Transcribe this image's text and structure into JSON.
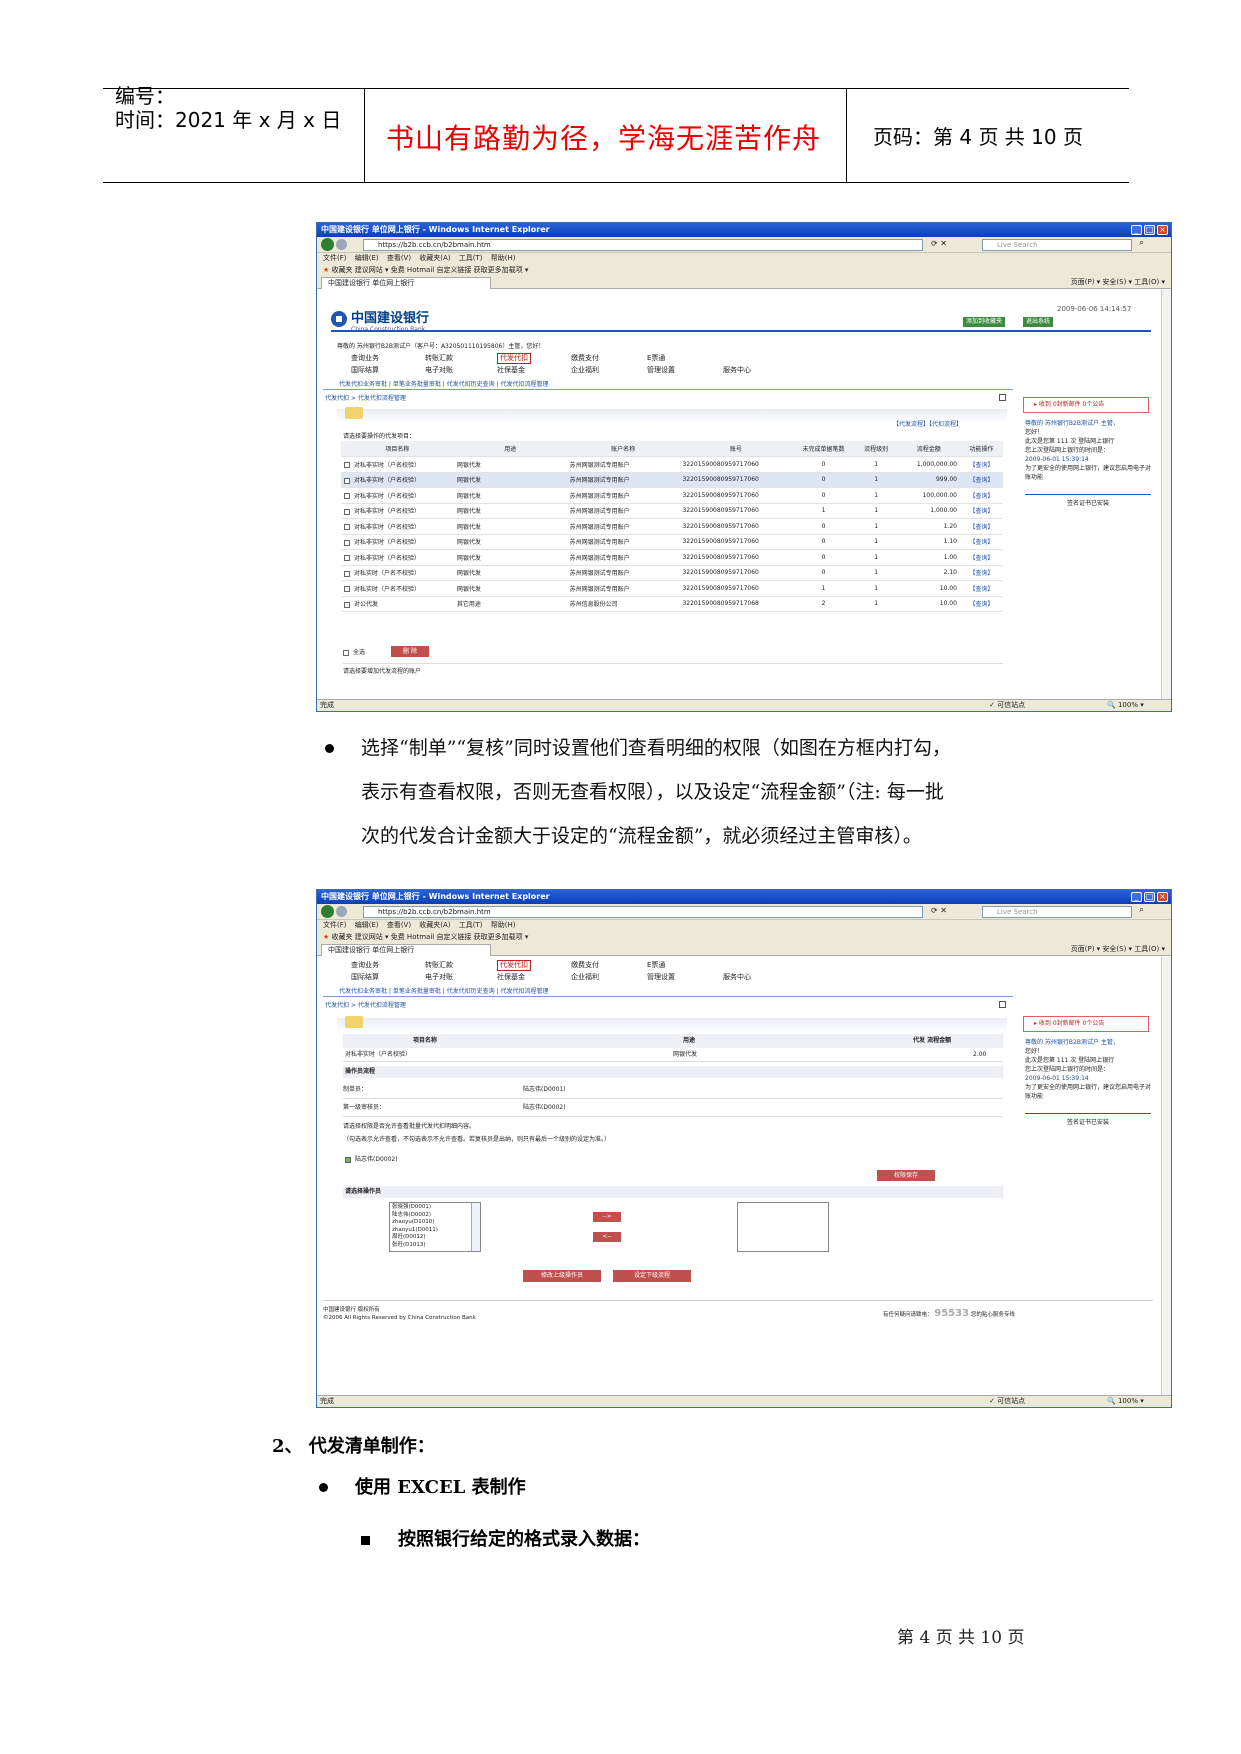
{
  "header": {
    "number_label": "编号：",
    "time_label": "时间：2021 年 x 月 x 日",
    "motto": "书山有路勤为径，学海无涯苦作舟",
    "page_label": "页码：第 4 页  共 10 页"
  },
  "browser": {
    "title": "中国建设银行 单位网上银行 - Windows Internet Explorer",
    "address1": "https://b2b.ccb.cn/b2bmain.htm",
    "address2": "https://b2b.ccb.cn/b2bmain.htm",
    "search_placeholder": "Live Search",
    "menu": "文件(F) 编辑(E) 查看(V) 收藏夹(A) 工具(T) 帮助(H)",
    "favorites": "收藏夹   建议网站 ▾   免费 Hotmail   自定义链接   获取更多加载项 ▾",
    "tab": "中国建设银行 单位网上银行",
    "tools": "页面(P) ▾  安全(S) ▾  工具(O) ▾",
    "status_done": "完成",
    "status_zone": "可信站点",
    "status_zoom": "100%"
  },
  "bank": {
    "name": "中国建设银行",
    "name_en": "China Construction Bank",
    "datetime": "2009-06-06 14:14:57",
    "btn_favorite": "添加到收藏夹",
    "btn_exit": "退出系统",
    "welcome": "尊敬的 苏州银行B2B测试户（客户号：A320501110195806）主管，您好！",
    "nav_row1": [
      "查询业务",
      "转账汇款",
      "代发代扣",
      "缴费支付",
      "E票通"
    ],
    "nav_row2": [
      "国际结算",
      "电子对账",
      "社保基金",
      "企业福利",
      "管理设置",
      "服务中心"
    ],
    "subnav": "代发代扣业务审批 | 单笔业务批量审批 | 代发代扣历史查询 | 代发代扣流程管理",
    "breadcrumb": "代发代扣 > 代发代扣流程管理"
  },
  "window1": {
    "top_links": "【代发流程】【代扣流程】",
    "prompt": "请选择要操作的代发项目：",
    "columns": [
      "项目名称",
      "用途",
      "账户名称",
      "账号",
      "未完成单据笔数",
      "流程级别",
      "流程金额",
      "功能操作"
    ],
    "rows": [
      [
        "对私非实时（户名校验）",
        "网银代发",
        "苏州网银测试专用账户",
        "32201590080959717060",
        "0",
        "1",
        "1,000,000.00",
        "【查询】"
      ],
      [
        "对私非实时（户名校验）",
        "网银代发",
        "苏州网银测试专用账户",
        "32201590080959717060",
        "0",
        "1",
        "999.00",
        "【查询】"
      ],
      [
        "对私非实时（户名校验）",
        "网银代发",
        "苏州网银测试专用账户",
        "32201590080959717060",
        "0",
        "1",
        "100,000.00",
        "【查询】"
      ],
      [
        "对私非实时（户名校验）",
        "网银代发",
        "苏州网银测试专用账户",
        "32201590080959717060",
        "1",
        "1",
        "1,000.00",
        "【查询】"
      ],
      [
        "对私非实时（户名校验）",
        "网银代发",
        "苏州网银测试专用账户",
        "32201590080959717060",
        "0",
        "1",
        "1.20",
        "【查询】"
      ],
      [
        "对私非实时（户名校验）",
        "网银代发",
        "苏州网银测试专用账户",
        "32201590080959717060",
        "0",
        "1",
        "1.10",
        "【查询】"
      ],
      [
        "对私非实时（户名校验）",
        "网银代发",
        "苏州网银测试专用账户",
        "32201590080959717060",
        "0",
        "1",
        "1.00",
        "【查询】"
      ],
      [
        "对私实时（户名不校验）",
        "网银代发",
        "苏州网银测试专用账户",
        "32201590080959717060",
        "0",
        "1",
        "2.10",
        "【查询】"
      ],
      [
        "对私实时（户名不校验）",
        "网银代发",
        "苏州网银测试专用账户",
        "32201590080959717060",
        "1",
        "1",
        "10.00",
        "【查询】"
      ],
      [
        "对公代发",
        "其它用途",
        "苏州信息股份公司",
        "32201590080959717068",
        "2",
        "1",
        "10.00",
        "【查询】"
      ]
    ],
    "select_all": "全选",
    "delete_btn": "删 除",
    "bottom_note": "请选择要增加代发流程的账户"
  },
  "sidebar": {
    "mail": "▸ 收到 0封新邮件 0个公告",
    "greet1": "尊敬的 苏州银行B2B测试户 主管，",
    "greet2": "您好！",
    "login_count": "此次是您第 111 次 登陆网上银行",
    "last_login": "您上次登陆网上银行的时间是：",
    "last_time": "2009-06-01 15:39:14",
    "security": "为了更安全的使用网上银行，建议您启用电子对账功能",
    "cert": "签名证书已安装"
  },
  "window2": {
    "col_name": "项目名称",
    "col_use": "用途",
    "col_amount": "代发 流程金额",
    "item_name": "对私非实时（户名校验）",
    "item_use": "网银代发",
    "item_amount": "2.00",
    "ops_title": "操作员流程",
    "maker_label": "制单员：",
    "maker_value": "陆志伟(D0001)",
    "checker_label": "第一级审核员：",
    "checker_value": "陆志伟(D0002)",
    "note1": "请选择权限是否允许查看批量代发代扣明细内容。",
    "note2": "（勾选表示允许查看，不勾选表示不允许查看。若复核员是出纳，则只有最后一个级别的设定为准。）",
    "perm_item": "陆志伟(D0002)",
    "save_btn": "权限保存",
    "choose_ops": "请选择操作员",
    "operators": [
      "张晓强(D0001)",
      "陆志伟(D0002)",
      "zhaoyu(D1010)",
      "zhaoyu1(D0011)",
      "周旺(D0012)",
      "张旺(D1013)"
    ],
    "add_btn": "-->",
    "remove_btn": "<--",
    "prev_btn": "修改上级操作员",
    "next_btn": "设定下级流程",
    "copyright1": "中国建设银行 版权所有",
    "copyright2": "©2006 All Rights Reserved by China Construction Bank",
    "hotline_label": "有任何疑问请致电：",
    "hotline": "95533",
    "hotline_tail": "您的贴心服务专线"
  },
  "content": {
    "bullet1_line1": "选择“制单”“复核”同时设置他们查看明细的权限（如图在方框内打勾，",
    "bullet1_line2": "表示有查看权限，否则无查看权限），以及设定“流程金额”（注: 每一批",
    "bullet1_line3": "次的代发合计金额大于设定的“流程金额”，就必须经过主管审核）。",
    "section2": "2、 代发清单制作：",
    "bullet2": "使用 EXCEL 表制作",
    "bullet3": "按照银行给定的格式录入数据："
  },
  "footer": "第 4 页  共 10 页",
  "colors": {
    "motto": "#ee0000",
    "titlebar": "#0a3fb8",
    "bank_blue": "#003f8a",
    "button_red": "#c0504d"
  }
}
